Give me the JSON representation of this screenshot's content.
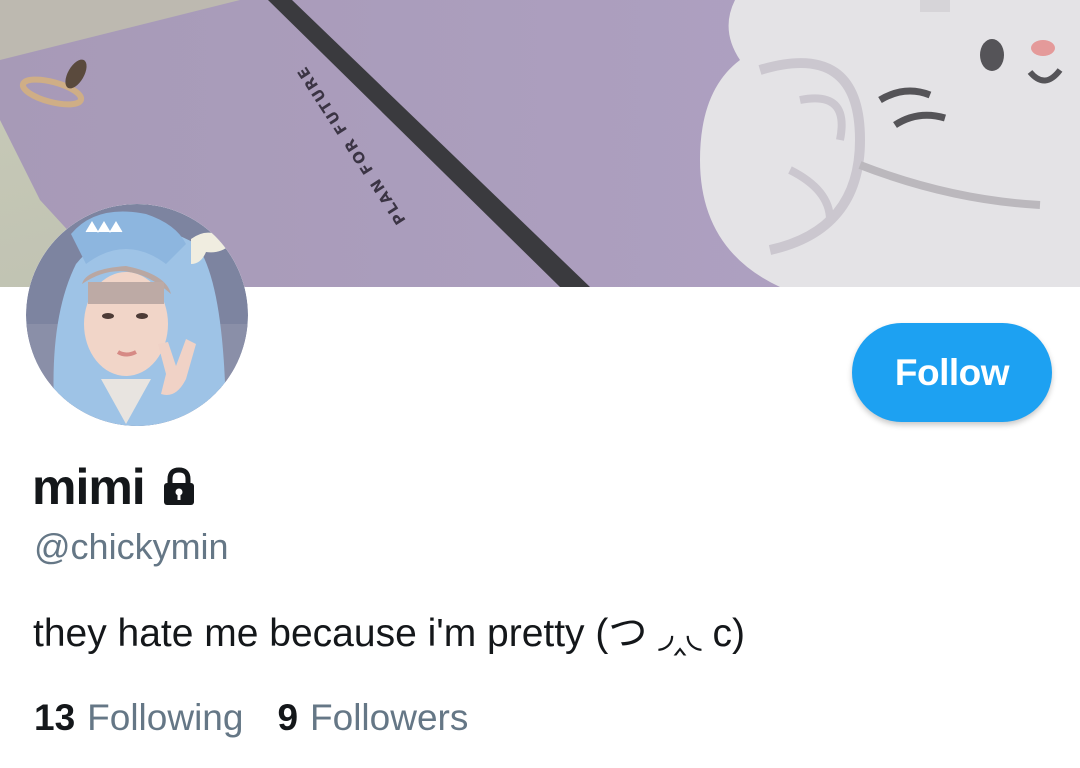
{
  "profile": {
    "display_name": "mimi",
    "handle": "@chickymin",
    "bio": "they hate me because i'm pretty (つ ◞‸◟ c)",
    "protected": true
  },
  "banner": {
    "printed_text": "PLAN FOR FUTURE",
    "background_color": "#a99bbf"
  },
  "actions": {
    "follow_label": "Follow",
    "accent_color": "#1da1f2"
  },
  "stats": {
    "following_count": "13",
    "following_label": "Following",
    "followers_count": "9",
    "followers_label": "Followers"
  },
  "icons": {
    "lock": "lock-icon"
  }
}
